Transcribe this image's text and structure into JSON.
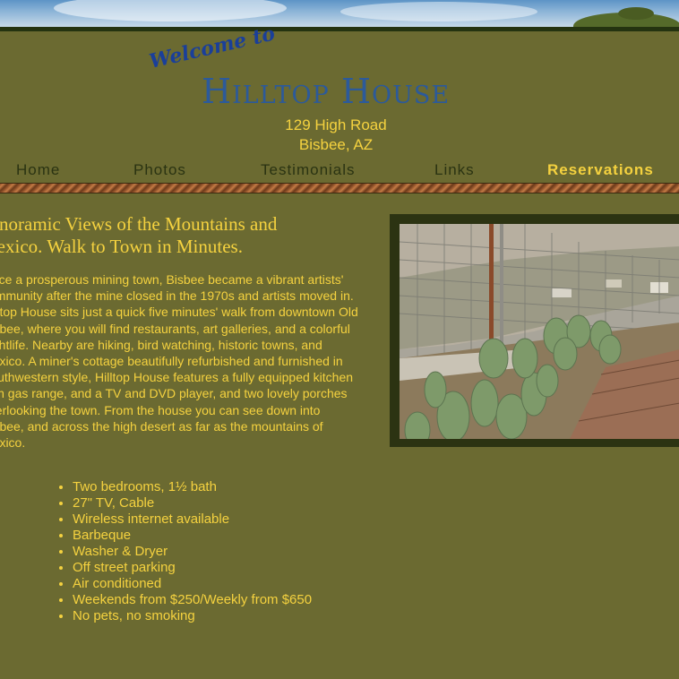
{
  "header": {
    "welcome": "Welcome to",
    "brand": "Hilltop House",
    "address_line1": "129 High Road",
    "address_line2": "Bisbee, AZ"
  },
  "nav": {
    "items": [
      {
        "label": "Home",
        "active": false
      },
      {
        "label": "Photos",
        "active": false
      },
      {
        "label": "Testimonials",
        "active": false
      },
      {
        "label": "Links",
        "active": false
      },
      {
        "label": "Reservations",
        "active": true
      }
    ]
  },
  "main": {
    "headline": "Panoramic Views of the Mountains and Mexico. Walk to Town in Minutes.",
    "intro": "Once a prosperous mining town, Bisbee became a vibrant artists' community after the mine closed in the 1970s and artists moved in. Hilltop House sits just a quick five minutes' walk from downtown Old Bisbee, where you will find restaurants, art galleries, and a colorful nightlife. Nearby are hiking, bird watching, historic towns, and Mexico. A miner's cottage beautifully refurbished and furnished in Southwestern style, Hilltop House features a fully equipped kitchen with gas range, and a TV and DVD player, and two lovely porches overlooking the town. From the house you can see down into Bisbee, and across the high desert as far as the mountains of Mexico.",
    "features": [
      "Two bedrooms, 1½ bath",
      "27\" TV, Cable",
      "Wireless internet available",
      "Barbeque",
      "Washer & Dryer",
      "Off street parking",
      "Air conditioned",
      "Weekends from $250/Weekly from $650",
      "No pets, no smoking"
    ]
  },
  "colors": {
    "background": "#6b6a31",
    "accent_text": "#f5d23f",
    "nav_text": "#2a3312",
    "brand": "#2c5a9a"
  }
}
